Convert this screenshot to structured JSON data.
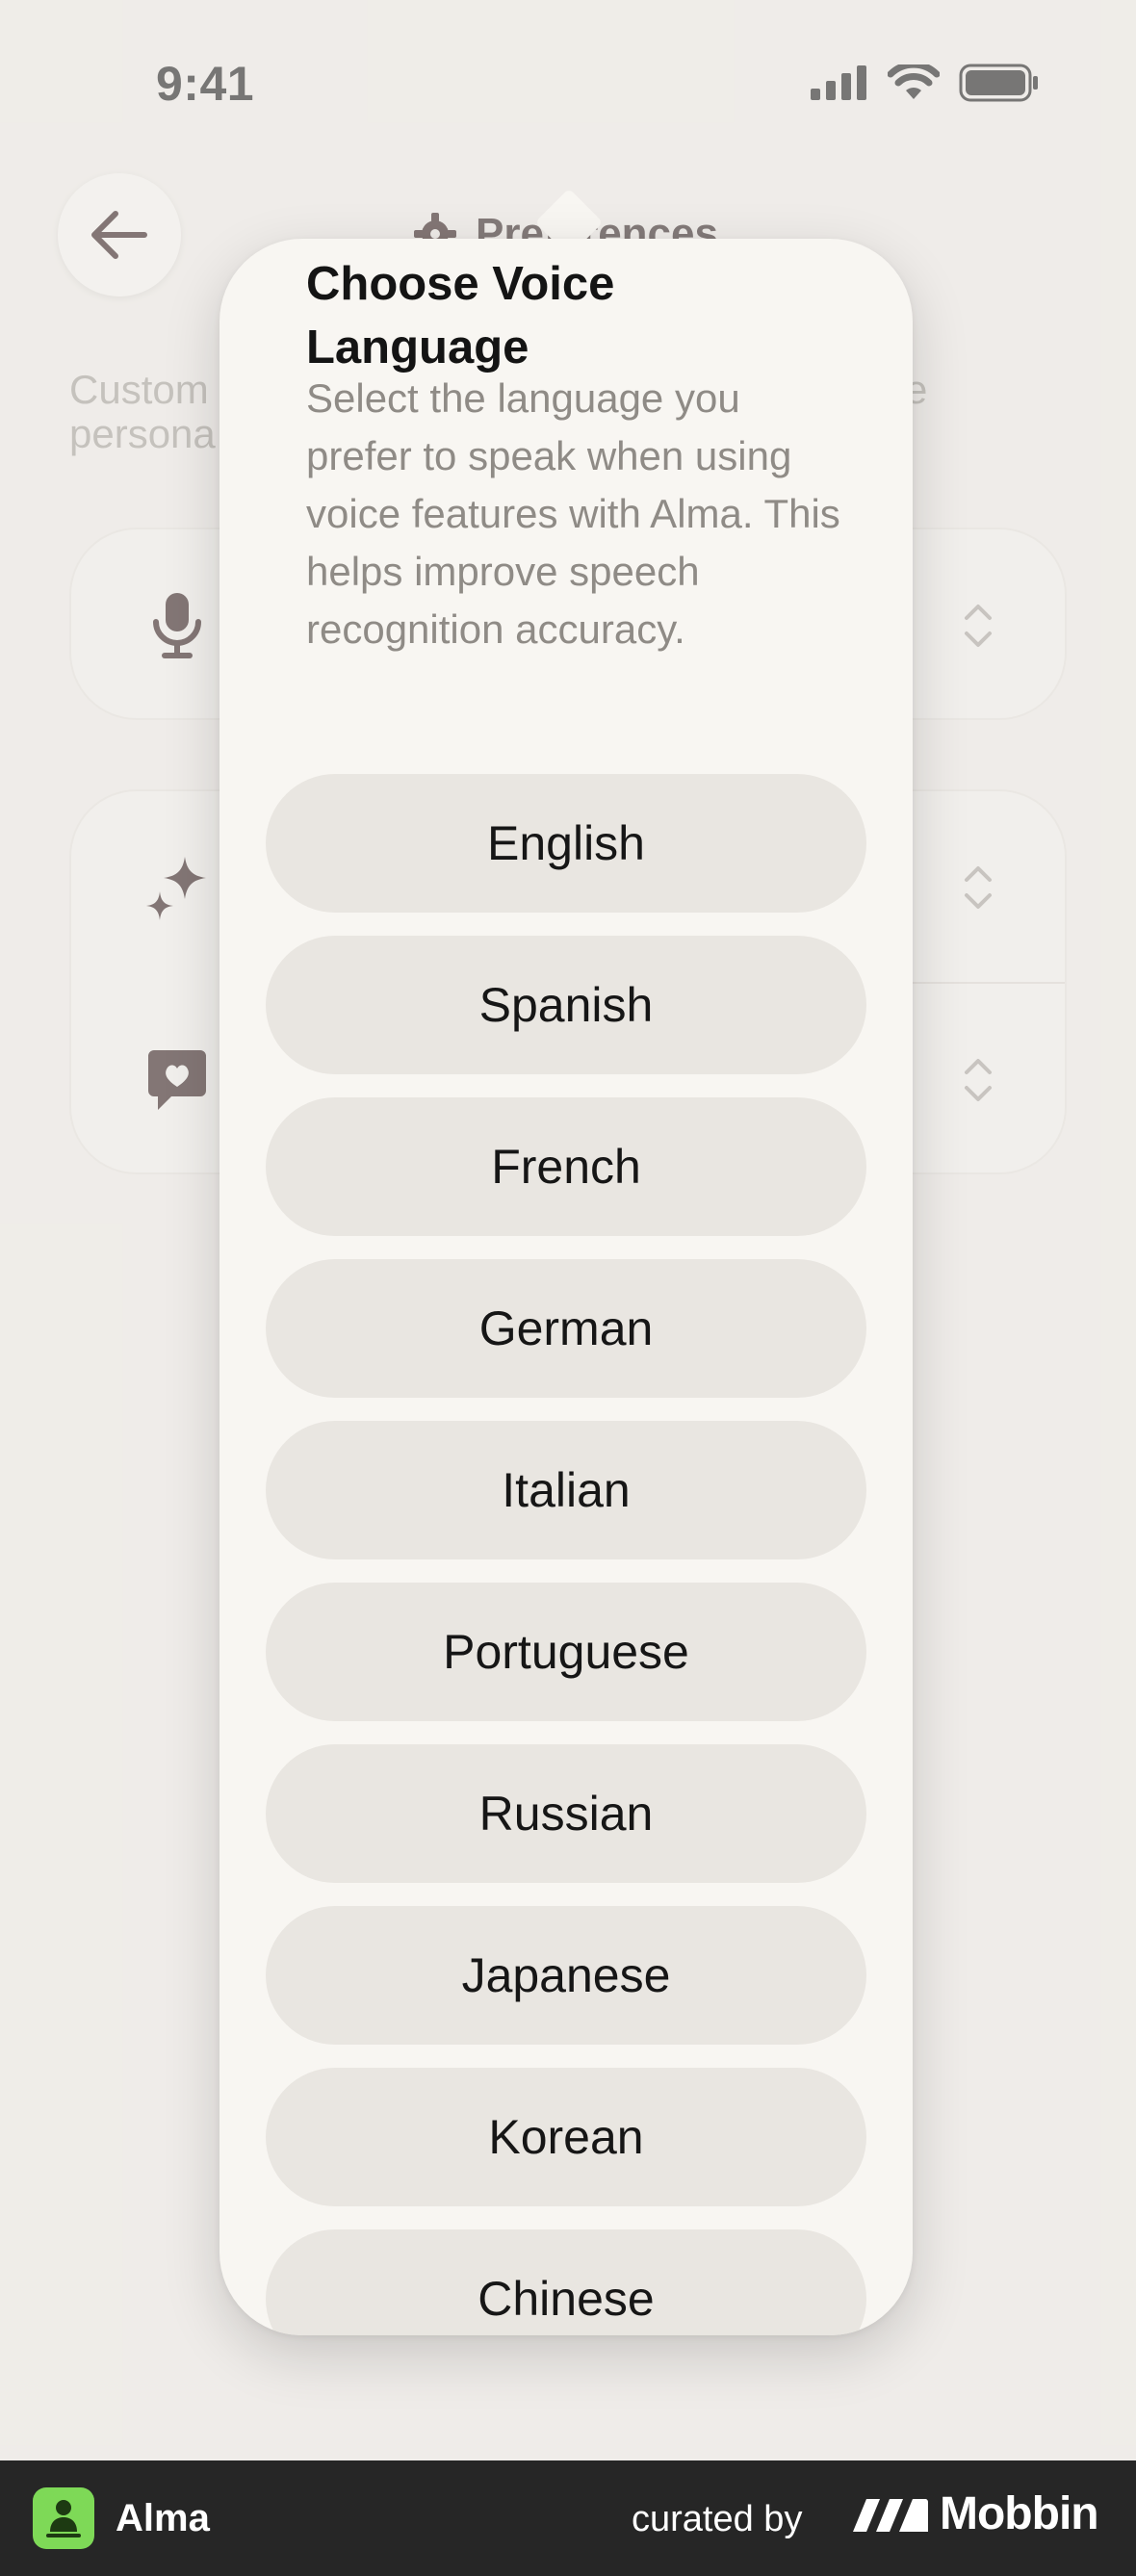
{
  "status_bar": {
    "time": "9:41"
  },
  "header": {
    "title": "Preferences"
  },
  "background": {
    "subtitle_visible_left": "Custom",
    "subtitle_visible_left_line2": "persona",
    "subtitle_visible_right": "e"
  },
  "popover": {
    "title": "Choose Voice Language",
    "description": "Select the language you prefer to speak when using voice features with Alma. This helps improve speech recognition accuracy.",
    "languages": [
      "English",
      "Spanish",
      "French",
      "German",
      "Italian",
      "Portuguese",
      "Russian",
      "Japanese",
      "Korean",
      "Chinese"
    ]
  },
  "bottom_bar": {
    "app_name": "Alma",
    "curated_by": "curated by",
    "brand": "Mobbin"
  },
  "colors": {
    "background": "#efece7",
    "popover": "#f8f6f2",
    "option": "#e9e6e1",
    "icon_dark": "#2a1515",
    "alma_green": "#7ed957",
    "bottom_bar": "#262626"
  }
}
